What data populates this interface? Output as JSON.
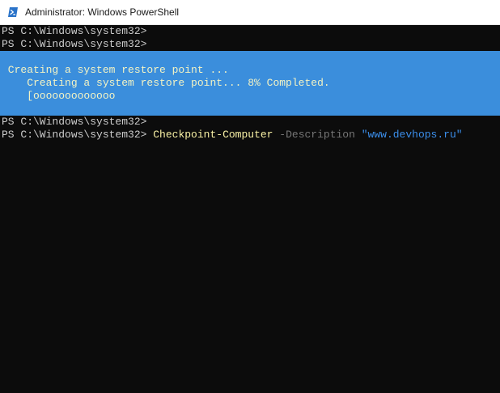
{
  "window": {
    "title": "Administrator: Windows PowerShell",
    "icon": "powershell-icon"
  },
  "terminal": {
    "prompt": "PS C:\\Windows\\system32>",
    "lines_before": [
      "PS C:\\Windows\\system32>",
      "PS C:\\Windows\\system32>"
    ],
    "progress": {
      "activity": " Creating a system restore point ...",
      "status": "    Creating a system restore point... 8% Completed.",
      "bar": "    [ooooooooooooo",
      "percent_complete": 8
    },
    "lines_after": [
      "PS C:\\Windows\\system32>"
    ],
    "command": {
      "cmdlet": "Checkpoint-Computer",
      "parameter": "-Description",
      "argument": "\"www.devhops.ru\""
    }
  },
  "colors": {
    "background": "#0c0c0c",
    "foreground": "#cccccc",
    "progress_background": "#3b8edc",
    "cmdlet": "#f9f1a5",
    "parameter": "#767676",
    "string": "#3b8eea"
  }
}
